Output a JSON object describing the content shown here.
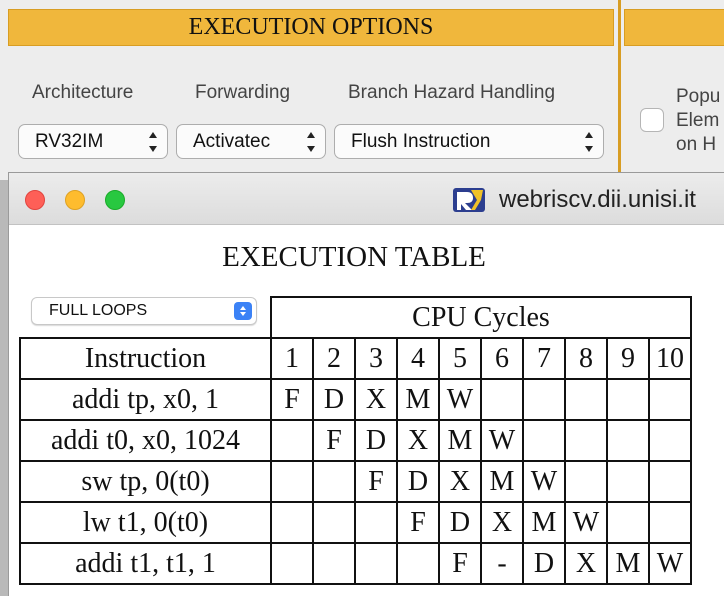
{
  "execution_options": {
    "header": "EXECUTION OPTIONS",
    "architecture": {
      "label": "Architecture",
      "value": "RV32IM"
    },
    "forwarding": {
      "label": "Forwarding",
      "value": "Activatec"
    },
    "branch_hazard": {
      "label": "Branch Hazard Handling",
      "value": "Flush Instruction"
    },
    "partial_text": {
      "line1": "Popu",
      "line2": "Elem",
      "line3": "on H"
    }
  },
  "popup": {
    "url": "webriscv.dii.unisi.it",
    "title": "EXECUTION TABLE",
    "loop_mode": "FULL LOOPS",
    "table": {
      "cycles_header": "CPU Cycles",
      "instruction_header": "Instruction",
      "cycles": [
        "1",
        "2",
        "3",
        "4",
        "5",
        "6",
        "7",
        "8",
        "9",
        "10"
      ],
      "rows": [
        {
          "instruction": "addi tp, x0, 1",
          "stages": [
            "F",
            "D",
            "X",
            "M",
            "W",
            "",
            "",
            "",
            "",
            ""
          ]
        },
        {
          "instruction": "addi t0, x0, 1024",
          "stages": [
            "",
            "F",
            "D",
            "X",
            "M",
            "W",
            "",
            "",
            "",
            ""
          ]
        },
        {
          "instruction": "sw tp, 0(t0)",
          "stages": [
            "",
            "",
            "F",
            "D",
            "X",
            "M",
            "W",
            "",
            "",
            ""
          ]
        },
        {
          "instruction": "lw t1, 0(t0)",
          "stages": [
            "",
            "",
            "",
            "F",
            "D",
            "X",
            "M",
            "W",
            "",
            ""
          ]
        },
        {
          "instruction": "addi t1, t1, 1",
          "stages": [
            "",
            "",
            "",
            "",
            "F",
            "-",
            "D",
            "X",
            "M",
            "W"
          ]
        }
      ]
    }
  },
  "colors": {
    "header_orange": "#f0b73c",
    "close": "#fe5f57",
    "minimize": "#febc2e",
    "zoom": "#28c840",
    "select_accent": "#3b82f6"
  }
}
